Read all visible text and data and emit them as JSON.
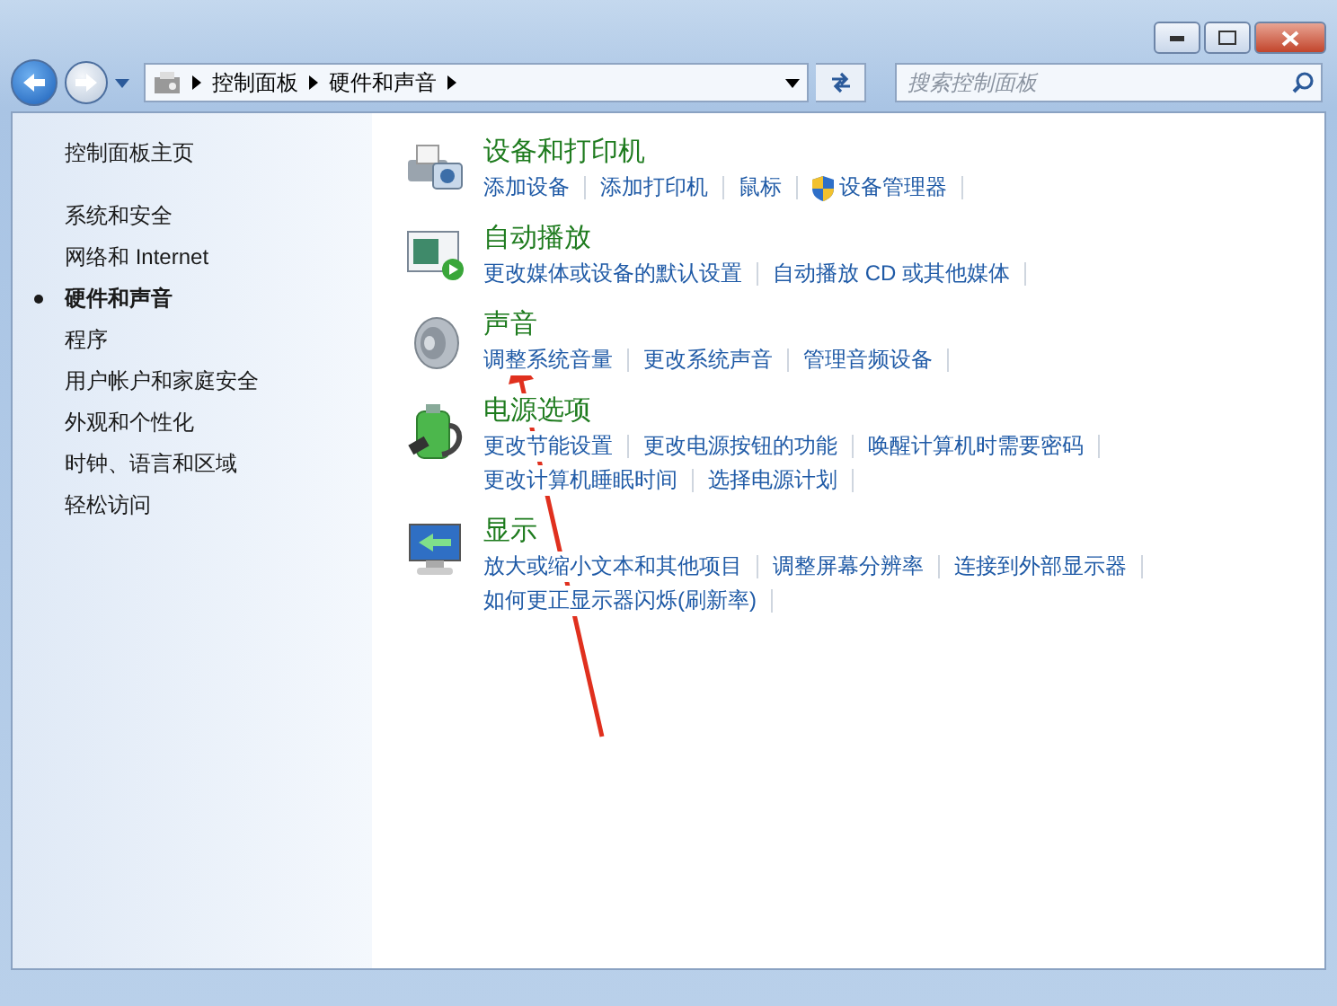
{
  "address_bar": {
    "breadcrumb": [
      "控制面板",
      "硬件和声音"
    ]
  },
  "search": {
    "placeholder": "搜索控制面板"
  },
  "sidebar": {
    "items": [
      {
        "label": "控制面板主页",
        "kind": "home",
        "selected": false
      },
      {
        "label": "系统和安全",
        "kind": "category",
        "selected": false
      },
      {
        "label": "网络和 Internet",
        "kind": "category",
        "selected": false
      },
      {
        "label": "硬件和声音",
        "kind": "category",
        "selected": true
      },
      {
        "label": "程序",
        "kind": "category",
        "selected": false
      },
      {
        "label": "用户帐户和家庭安全",
        "kind": "category",
        "selected": false
      },
      {
        "label": "外观和个性化",
        "kind": "category",
        "selected": false
      },
      {
        "label": "时钟、语言和区域",
        "kind": "category",
        "selected": false
      },
      {
        "label": "轻松访问",
        "kind": "category",
        "selected": false
      }
    ]
  },
  "sections": [
    {
      "kind": "devices",
      "title": "设备和打印机",
      "rows": [
        [
          {
            "label": "添加设备",
            "shield": false
          },
          {
            "label": "添加打印机",
            "shield": false
          },
          {
            "label": "鼠标",
            "shield": false
          },
          {
            "label": "设备管理器",
            "shield": true
          }
        ]
      ]
    },
    {
      "kind": "autoplay",
      "title": "自动播放",
      "rows": [
        [
          {
            "label": "更改媒体或设备的默认设置",
            "shield": false
          },
          {
            "label": "自动播放 CD 或其他媒体",
            "shield": false
          }
        ]
      ]
    },
    {
      "kind": "sound",
      "title": "声音",
      "rows": [
        [
          {
            "label": "调整系统音量",
            "shield": false
          },
          {
            "label": "更改系统声音",
            "shield": false
          },
          {
            "label": "管理音频设备",
            "shield": false
          }
        ]
      ]
    },
    {
      "kind": "power",
      "title": "电源选项",
      "rows": [
        [
          {
            "label": "更改节能设置",
            "shield": false
          },
          {
            "label": "更改电源按钮的功能",
            "shield": false
          },
          {
            "label": "唤醒计算机时需要密码",
            "shield": false
          }
        ],
        [
          {
            "label": "更改计算机睡眠时间",
            "shield": false
          },
          {
            "label": "选择电源计划",
            "shield": false
          }
        ]
      ]
    },
    {
      "kind": "display",
      "title": "显示",
      "rows": [
        [
          {
            "label": "放大或缩小文本和其他项目",
            "shield": false
          },
          {
            "label": "调整屏幕分辨率",
            "shield": false
          },
          {
            "label": "连接到外部显示器",
            "shield": false
          }
        ],
        [
          {
            "label": "如何更正显示器闪烁(刷新率)",
            "shield": false
          }
        ]
      ]
    }
  ]
}
